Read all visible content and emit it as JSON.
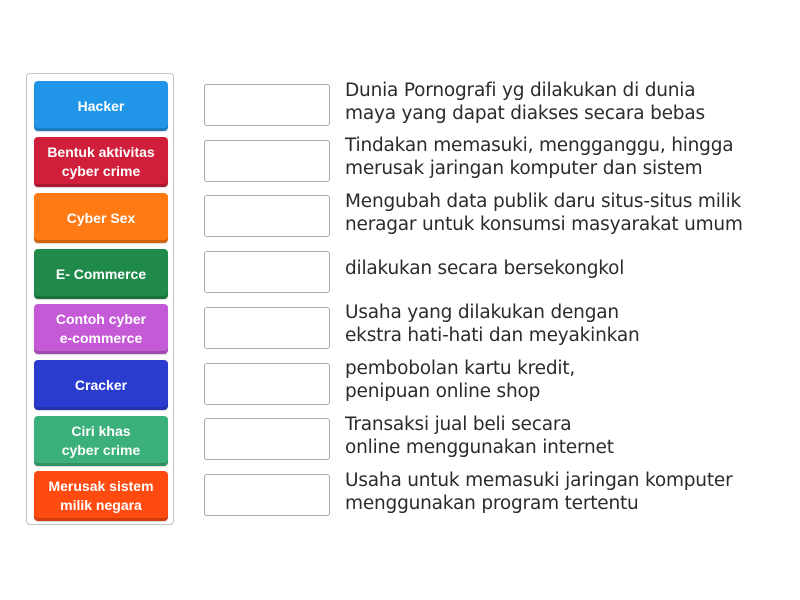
{
  "tiles": [
    {
      "label": "Hacker",
      "color": "#2196e8"
    },
    {
      "label": "Bentuk aktivitas\ncyber crime",
      "color": "#d01f3a"
    },
    {
      "label": "Cyber Sex",
      "color": "#ff7a12"
    },
    {
      "label": "E- Commerce",
      "color": "#1f8a4a"
    },
    {
      "label": "Contoh cyber\ne-commerce",
      "color": "#c45ad6"
    },
    {
      "label": "Cracker",
      "color": "#2a3bd0"
    },
    {
      "label": "Ciri khas\ncyber crime",
      "color": "#3bb07a"
    },
    {
      "label": "Merusak sistem\nmilik negara",
      "color": "#ff4a10"
    }
  ],
  "rows": [
    {
      "slot_value": "",
      "clue": "Dunia Pornografi yg dilakukan di dunia\nmaya yang dapat diakses secara bebas"
    },
    {
      "slot_value": "",
      "clue": "Tindakan memasuki, mengganggu, hingga\nmerusak jaringan komputer dan sistem"
    },
    {
      "slot_value": "",
      "clue": "Mengubah data publik daru situs-situs milik\nneragar untuk konsumsi masyarakat umum"
    },
    {
      "slot_value": "",
      "clue": "dilakukan secara bersekongkol"
    },
    {
      "slot_value": "",
      "clue": "Usaha yang dilakukan dengan\nekstra hati-hati dan meyakinkan"
    },
    {
      "slot_value": "",
      "clue": "pembobolan kartu kredit,\npenipuan online shop"
    },
    {
      "slot_value": "",
      "clue": "Transaksi jual beli secara\nonline menggunakan internet"
    },
    {
      "slot_value": "",
      "clue": "Usaha untuk memasuki jaringan komputer\nmenggunakan program tertentu"
    }
  ]
}
